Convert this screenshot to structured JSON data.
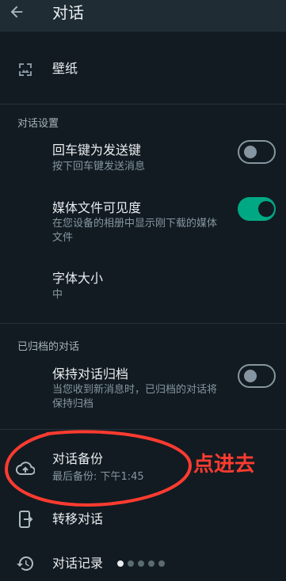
{
  "header": {
    "title": "对话"
  },
  "wallpaper": {
    "label": "壁纸"
  },
  "chat_settings": {
    "section_title": "对话设置",
    "enter_send": {
      "title": "回车键为发送键",
      "subtitle": "按下回车键发送消息",
      "enabled": false
    },
    "media_visibility": {
      "title": "媒体文件可见度",
      "subtitle": "在您设备的相册中显示刚下载的媒体文件",
      "enabled": true
    },
    "font_size": {
      "title": "字体大小",
      "value": "中"
    }
  },
  "archived": {
    "section_title": "已归档的对话",
    "keep_archived": {
      "title": "保持对话归档",
      "subtitle": "当您收到新消息时，已归档的对话将保持归档",
      "enabled": false
    }
  },
  "backup": {
    "title": "对话备份",
    "subtitle": "最后备份: 下午1:45"
  },
  "transfer": {
    "label": "转移对话"
  },
  "history": {
    "label": "对话记录"
  },
  "annotation": {
    "text": "点进去",
    "color": "#ff3b30"
  },
  "pagination": {
    "count": 5,
    "active_index": 0
  },
  "colors": {
    "background": "#121b22",
    "header": "#1f2c34",
    "accent": "#00a884",
    "text_secondary": "#8696a0"
  }
}
